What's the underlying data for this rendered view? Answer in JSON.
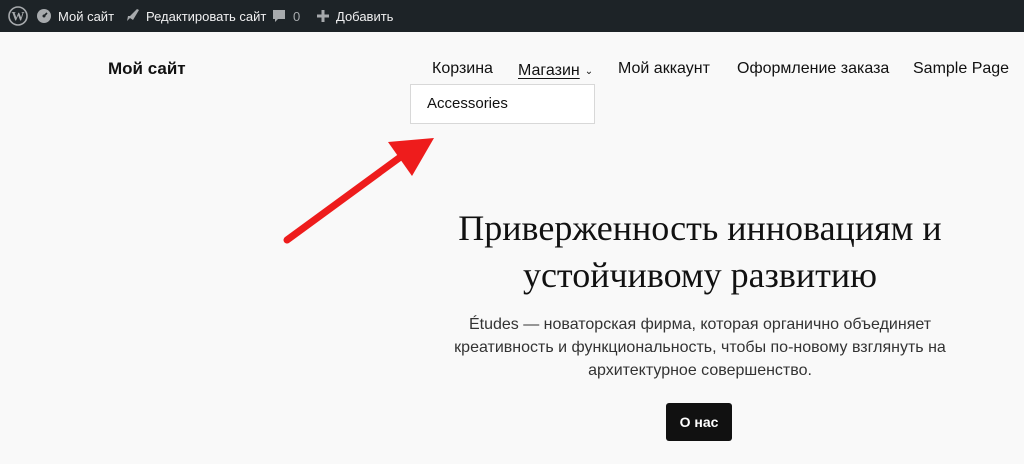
{
  "admin_bar": {
    "wp_logo_icon": "wordpress-icon",
    "site_icon": "dashboard-icon",
    "site_name": "Мой сайт",
    "edit_icon": "brush-icon",
    "edit_label": "Редактировать сайт",
    "comments_icon": "comment-icon",
    "comments_count": "0",
    "new_icon": "plus-icon",
    "new_label": "Добавить"
  },
  "site": {
    "title": "Мой сайт"
  },
  "nav": {
    "cart": "Корзина",
    "shop": "Магазин",
    "account": "Мой аккаунт",
    "checkout": "Оформление заказа",
    "sample": "Sample Page",
    "shop_submenu": [
      "Accessories"
    ]
  },
  "hero": {
    "title": "Приверженность инновациям и устойчивому развитию",
    "text": "Études — новаторская фирма, которая органично объединяет креативность и функциональность, чтобы по-новому взглянуть на архитектурное совершенство.",
    "button": "О нас"
  },
  "colors": {
    "admin_bar_bg": "#1d2327",
    "page_bg": "#f9f9f9",
    "annotation_arrow": "#ee1c1c",
    "button_bg": "#111111"
  }
}
